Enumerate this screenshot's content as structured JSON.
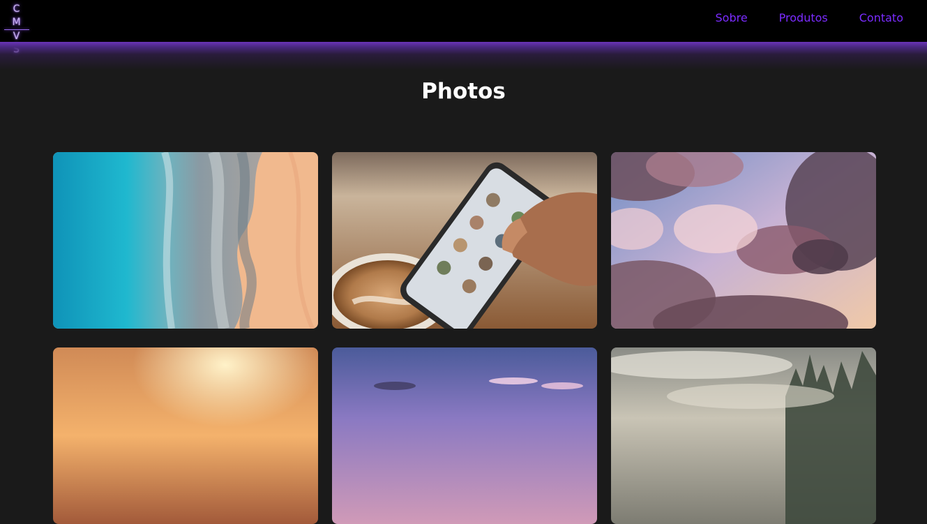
{
  "header": {
    "logo": {
      "top": "C M",
      "bottom": "V S"
    },
    "nav": [
      {
        "label": "Sobre"
      },
      {
        "label": "Produtos"
      },
      {
        "label": "Contato"
      }
    ],
    "nav_color": "#7b2cff",
    "accent_glow": "#6a34b8"
  },
  "main": {
    "title": "Photos",
    "photos": [
      {
        "subject": "aerial-beach"
      },
      {
        "subject": "phone-and-coffee"
      },
      {
        "subject": "pink-clouds"
      },
      {
        "subject": "sunset-sky"
      },
      {
        "subject": "purple-sky"
      },
      {
        "subject": "misty-landscape"
      }
    ]
  }
}
